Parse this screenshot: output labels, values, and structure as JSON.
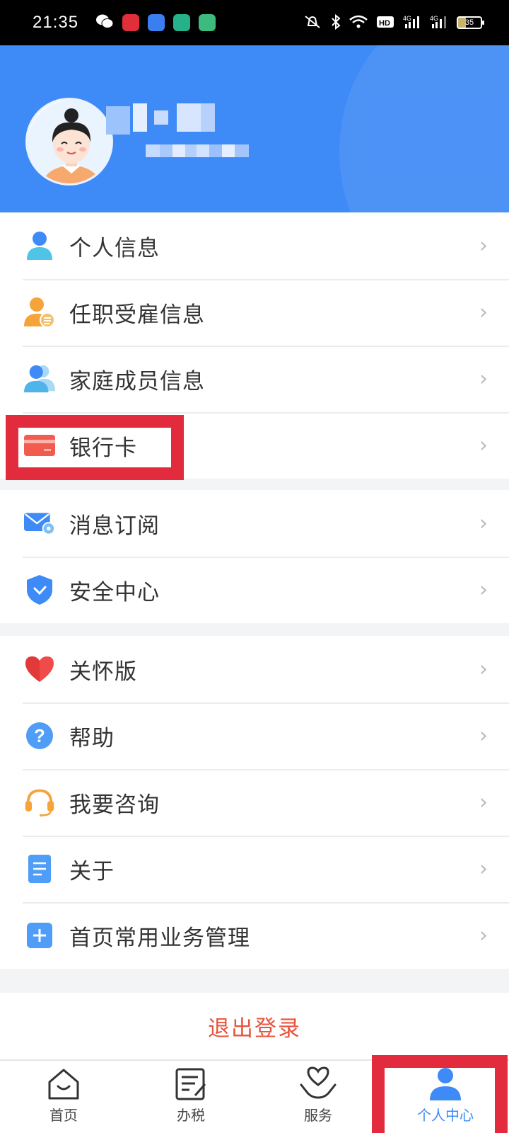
{
  "status_bar": {
    "time": "21:35",
    "battery": "35",
    "network": "4G"
  },
  "menu": {
    "group1": [
      {
        "id": "personal-info",
        "label": "个人信息",
        "icon": "person-icon"
      },
      {
        "id": "employment-info",
        "label": "任职受雇信息",
        "icon": "employee-icon"
      },
      {
        "id": "family-info",
        "label": "家庭成员信息",
        "icon": "family-icon"
      },
      {
        "id": "bank-card",
        "label": "银行卡",
        "icon": "bank-card-icon"
      }
    ],
    "group2": [
      {
        "id": "message-subscription",
        "label": "消息订阅",
        "icon": "mail-icon"
      },
      {
        "id": "security-center",
        "label": "安全中心",
        "icon": "shield-icon"
      }
    ],
    "group3": [
      {
        "id": "care-mode",
        "label": "关怀版",
        "icon": "heart-icon"
      },
      {
        "id": "help",
        "label": "帮助",
        "icon": "question-icon"
      },
      {
        "id": "consult",
        "label": "我要咨询",
        "icon": "headset-icon"
      },
      {
        "id": "about",
        "label": "关于",
        "icon": "document-icon"
      },
      {
        "id": "home-business-manage",
        "label": "首页常用业务管理",
        "icon": "plus-icon"
      }
    ]
  },
  "logout": {
    "label": "退出登录"
  },
  "tabbar": {
    "tabs": [
      {
        "label": "首页",
        "icon": "home-icon"
      },
      {
        "label": "办税",
        "icon": "tax-icon"
      },
      {
        "label": "服务",
        "icon": "service-icon"
      },
      {
        "label": "个人中心",
        "icon": "person-center-icon"
      }
    ]
  },
  "colors": {
    "header": "#3e8af6",
    "accent": "#3e8af6",
    "logout": "#e8533d",
    "highlight": "#e22b3c"
  }
}
